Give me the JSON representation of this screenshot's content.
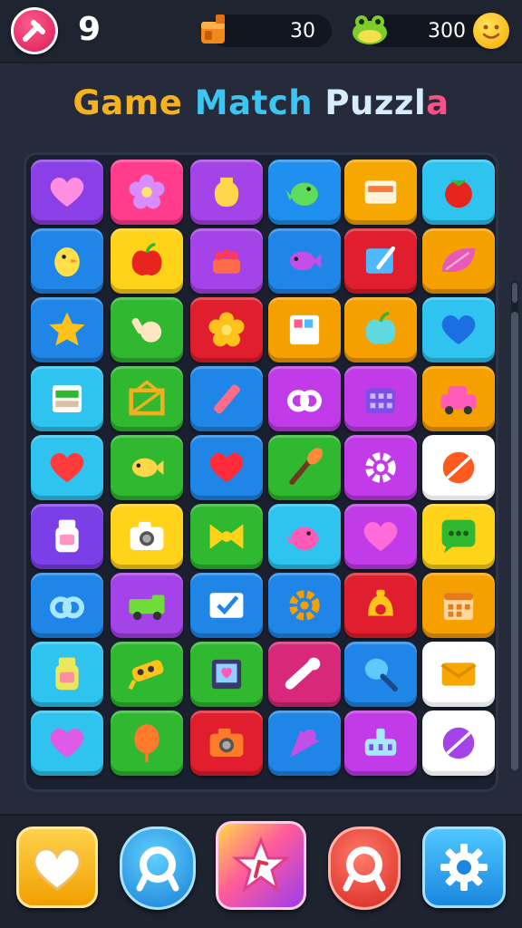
{
  "header": {
    "level": "9",
    "moves": "30",
    "coins": "300",
    "icons": {
      "back": "exit-icon",
      "moves": "fuel-can-icon",
      "coins": "frog-icon",
      "profile": "smiley-icon"
    }
  },
  "title": {
    "part1": "Game",
    "part2": "Match",
    "part3": "Puzzl",
    "part4": "a"
  },
  "board": {
    "columns": 6,
    "tiles": [
      {
        "color": "#8b3fe6",
        "icon": "heart-icon",
        "fg": "#ff8de0"
      },
      {
        "color": "#ff3d8c",
        "icon": "flower-icon",
        "fg": "#d88cff"
      },
      {
        "color": "#a443e8",
        "icon": "vase-icon",
        "fg": "#ffd64a"
      },
      {
        "color": "#1f8ff0",
        "icon": "bird-icon",
        "fg": "#5fdc5a"
      },
      {
        "color": "#f6a800",
        "icon": "screen-icon",
        "fg": "#ff7a3a"
      },
      {
        "color": "#2fc4f0",
        "icon": "tomato-icon",
        "fg": "#e8241f"
      },
      {
        "color": "#1f86e8",
        "icon": "chick-icon",
        "fg": "#ffe04a"
      },
      {
        "color": "#ffd31a",
        "icon": "apple-icon",
        "fg": "#e8241f"
      },
      {
        "color": "#a443e8",
        "icon": "cake-icon",
        "fg": "#ff6b4a"
      },
      {
        "color": "#1f86e8",
        "icon": "fish-icon",
        "fg": "#c44fe8"
      },
      {
        "color": "#e01e2e",
        "icon": "tablet-icon",
        "fg": "#4fb8ff"
      },
      {
        "color": "#f6a000",
        "icon": "leaf-icon",
        "fg": "#e85ab8"
      },
      {
        "color": "#1f86e8",
        "icon": "star-icon",
        "fg": "#ffc21a"
      },
      {
        "color": "#2fb830",
        "icon": "hand-icon",
        "fg": "#ffe6c2"
      },
      {
        "color": "#e01e2e",
        "icon": "flower-icon",
        "fg": "#ffc21a"
      },
      {
        "color": "#f6a000",
        "icon": "frame-icon",
        "fg": "#ffffff"
      },
      {
        "color": "#f6a000",
        "icon": "apple-icon",
        "fg": "#5fd8e0"
      },
      {
        "color": "#2fc4f0",
        "icon": "heart-icon",
        "fg": "#1b6fe0"
      },
      {
        "color": "#2fc4f0",
        "icon": "card-icon",
        "fg": "#ffffff"
      },
      {
        "color": "#2fb830",
        "icon": "crate-icon",
        "fg": "#f0b020"
      },
      {
        "color": "#1f86e8",
        "icon": "pencil-icon",
        "fg": "#ff6b8a"
      },
      {
        "color": "#c13ce8",
        "icon": "link-icon",
        "fg": "#ffffff"
      },
      {
        "color": "#c13ce8",
        "icon": "bag-icon",
        "fg": "#7b4fe8"
      },
      {
        "color": "#f6a000",
        "icon": "car-icon",
        "fg": "#ff5ab8"
      },
      {
        "color": "#2fc4f0",
        "icon": "heart-icon",
        "fg": "#ff3a3a"
      },
      {
        "color": "#2fb830",
        "icon": "fish-icon",
        "fg": "#ffd64a"
      },
      {
        "color": "#1f86e8",
        "icon": "heart-icon",
        "fg": "#ff2a3a"
      },
      {
        "color": "#2fb830",
        "icon": "brush-icon",
        "fg": "#ff8a3a"
      },
      {
        "color": "#c13ce8",
        "icon": "gear-icon",
        "fg": "#ffffff"
      },
      {
        "color": "#ffffff",
        "icon": "ball-icon",
        "fg": "#ff5a1f"
      },
      {
        "color": "#7b3fe8",
        "icon": "bottle-icon",
        "fg": "#ffffff"
      },
      {
        "color": "#ffd31a",
        "icon": "camera-icon",
        "fg": "#ffffff"
      },
      {
        "color": "#2fb830",
        "icon": "bow-icon",
        "fg": "#ffd31a"
      },
      {
        "color": "#2fc4f0",
        "icon": "bird-icon",
        "fg": "#ff5ab8"
      },
      {
        "color": "#c13ce8",
        "icon": "heart-icon",
        "fg": "#ff6bd8"
      },
      {
        "color": "#ffd31a",
        "icon": "chat-icon",
        "fg": "#2fb830"
      },
      {
        "color": "#1f86e8",
        "icon": "link-icon",
        "fg": "#a8e8ff"
      },
      {
        "color": "#a443e8",
        "icon": "truck-icon",
        "fg": "#6fdc3a"
      },
      {
        "color": "#1f86e8",
        "icon": "mail-icon",
        "fg": "#ffffff"
      },
      {
        "color": "#1f86e8",
        "icon": "gear-icon",
        "fg": "#f6a000"
      },
      {
        "color": "#e01e2e",
        "icon": "bell-icon",
        "fg": "#ffc21a"
      },
      {
        "color": "#f6a000",
        "icon": "calendar-icon",
        "fg": "#e87a1a"
      },
      {
        "color": "#2fc4f0",
        "icon": "bottle-icon",
        "fg": "#e8e85a"
      },
      {
        "color": "#2fb830",
        "icon": "tag-icon",
        "fg": "#ffc21a"
      },
      {
        "color": "#2fb830",
        "icon": "safe-icon",
        "fg": "#ff5ab8"
      },
      {
        "color": "#d8287a",
        "icon": "pin-icon",
        "fg": "#ffffff"
      },
      {
        "color": "#1f86e8",
        "icon": "pan-icon",
        "fg": "#5fc8ff"
      },
      {
        "color": "#ffffff",
        "icon": "envelope-icon",
        "fg": "#f6a800"
      },
      {
        "color": "#2fc4f0",
        "icon": "heart-icon",
        "fg": "#e05ae8"
      },
      {
        "color": "#2fb830",
        "icon": "balloon-icon",
        "fg": "#ff7a2a"
      },
      {
        "color": "#e01e2e",
        "icon": "camera-icon",
        "fg": "#ff7a2a"
      },
      {
        "color": "#1f86e8",
        "icon": "cone-icon",
        "fg": "#c44fe8"
      },
      {
        "color": "#c13ce8",
        "icon": "robot-icon",
        "fg": "#a8e8ff"
      },
      {
        "color": "#ffffff",
        "icon": "ball-icon",
        "fg": "#a443e8"
      }
    ]
  },
  "toolbar": {
    "buttons": [
      {
        "name": "heart-button",
        "icon": "heart-icon"
      },
      {
        "name": "search-button",
        "icon": "search-icon"
      },
      {
        "name": "star-button",
        "icon": "star-icon"
      },
      {
        "name": "search-button-red",
        "icon": "search-icon"
      },
      {
        "name": "settings-button",
        "icon": "gear-icon"
      }
    ]
  }
}
